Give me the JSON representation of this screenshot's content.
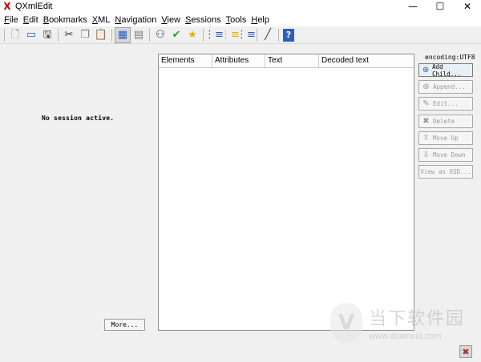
{
  "window": {
    "title": "QXmlEdit",
    "app_icon": "X",
    "minimize": "—",
    "maximize": "☐",
    "close": "✕"
  },
  "menu": [
    {
      "mnemonic": "F",
      "rest": "ile"
    },
    {
      "mnemonic": "E",
      "rest": "dit"
    },
    {
      "mnemonic": "B",
      "rest": "ookmarks"
    },
    {
      "mnemonic": "X",
      "rest": "ML"
    },
    {
      "mnemonic": "N",
      "rest": "avigation"
    },
    {
      "mnemonic": "V",
      "rest": "iew"
    },
    {
      "mnemonic": "S",
      "rest": "essions"
    },
    {
      "mnemonic": "T",
      "rest": "ools"
    },
    {
      "mnemonic": "H",
      "rest": "elp"
    }
  ],
  "toolbar": {
    "new": "🗋",
    "open": "▭",
    "save": "🖫",
    "cut": "✂",
    "copy": "❐",
    "paste": "📋",
    "view_a": "▦",
    "view_b": "▤",
    "find": "⚇",
    "validate": "✔",
    "bookmark": "★",
    "tree_a": "⋮≡",
    "tree_b": "⋮≡",
    "tree_c": "⋮≡",
    "pen": "╱",
    "help": "?"
  },
  "session": {
    "status": "No session active.",
    "more_label": "More..."
  },
  "tree": {
    "columns": [
      "Elements",
      "Attributes",
      "Text",
      "Decoded text"
    ]
  },
  "side": {
    "encoding": "encoding:UTF8",
    "buttons": [
      {
        "icon": "⊕",
        "label": "Add Child..."
      },
      {
        "icon": "⊕",
        "label": "Append..."
      },
      {
        "icon": "✎",
        "label": "Edit..."
      },
      {
        "icon": "✖",
        "label": "Delete"
      },
      {
        "icon": "⇧",
        "label": "Move Up"
      },
      {
        "icon": "⇩",
        "label": "Move Down"
      },
      {
        "icon": "",
        "label": "View as XSD..."
      }
    ]
  },
  "watermark": {
    "logo": "Ⅴ",
    "name": "当下软件园",
    "url": "www.downxia.com"
  },
  "status": {
    "icon": "✖"
  }
}
